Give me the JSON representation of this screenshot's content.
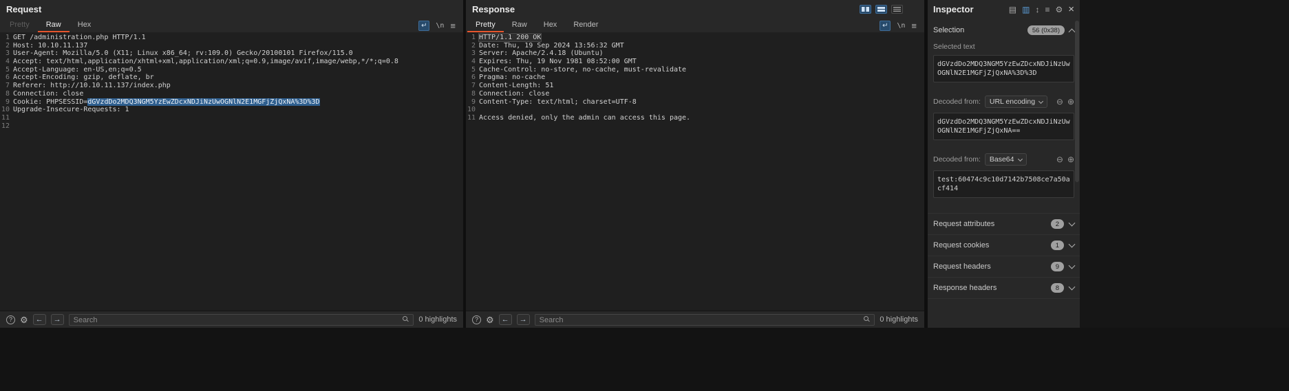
{
  "colors": {
    "accent_orange": "#e8562d",
    "selection_blue": "#2f5f8f",
    "active_icon_blue": "#274a6b"
  },
  "request": {
    "title": "Request",
    "tabs": [
      {
        "label": "Pretty",
        "state": "disabled"
      },
      {
        "label": "Raw",
        "state": "active"
      },
      {
        "label": "Hex",
        "state": "normal"
      }
    ],
    "lines": [
      {
        "num": "1",
        "spans": [
          {
            "t": "GET /administration.php HTTP/1.1"
          }
        ]
      },
      {
        "num": "2",
        "spans": [
          {
            "t": "Host: 10.10.11.137"
          }
        ]
      },
      {
        "num": "3",
        "spans": [
          {
            "t": "User-Agent: Mozilla/5.0 (X11; Linux x86_64; rv:109.0) Gecko/20100101 Firefox/115.0"
          }
        ]
      },
      {
        "num": "4",
        "spans": [
          {
            "t": "Accept: text/html,application/xhtml+xml,application/xml;q=0.9,image/avif,image/webp,*/*;q=0.8"
          }
        ]
      },
      {
        "num": "5",
        "spans": [
          {
            "t": "Accept-Language: en-US,en;q=0.5"
          }
        ]
      },
      {
        "num": "6",
        "spans": [
          {
            "t": "Accept-Encoding: gzip, deflate, br"
          }
        ]
      },
      {
        "num": "7",
        "spans": [
          {
            "t": "Referer: http://10.10.11.137/index.php"
          }
        ]
      },
      {
        "num": "8",
        "spans": [
          {
            "t": "Connection: close"
          }
        ]
      },
      {
        "num": "9",
        "spans": [
          {
            "t": "Cookie: PHPSESSID="
          },
          {
            "t": "dGVzdDo2MDQ3NGM5YzEwZDcxNDJiNzUwOGNlN2E1MGFjZjQxNA%3D%3D",
            "style": "selected"
          }
        ]
      },
      {
        "num": "10",
        "spans": [
          {
            "t": "Upgrade-Insecure-Requests: 1"
          }
        ]
      },
      {
        "num": "11",
        "spans": []
      },
      {
        "num": "12",
        "spans": []
      }
    ],
    "search": {
      "placeholder": "Search",
      "highlights": "0 highlights"
    }
  },
  "response": {
    "title": "Response",
    "tabs": [
      {
        "label": "Pretty",
        "state": "active"
      },
      {
        "label": "Raw",
        "state": "normal"
      },
      {
        "label": "Hex",
        "state": "normal"
      },
      {
        "label": "Render",
        "state": "normal"
      }
    ],
    "lines": [
      {
        "num": "1",
        "spans": [
          {
            "t": "HTTP/1.1 200 OK",
            "style": "boxed"
          }
        ]
      },
      {
        "num": "2",
        "spans": [
          {
            "t": "Date: Thu, 19 Sep 2024 13:56:32 GMT"
          }
        ]
      },
      {
        "num": "3",
        "spans": [
          {
            "t": "Server: Apache/2.4.18 (Ubuntu)"
          }
        ]
      },
      {
        "num": "4",
        "spans": [
          {
            "t": "Expires: Thu, 19 Nov 1981 08:52:00 GMT"
          }
        ]
      },
      {
        "num": "5",
        "spans": [
          {
            "t": "Cache-Control: no-store, no-cache, must-revalidate"
          }
        ]
      },
      {
        "num": "6",
        "spans": [
          {
            "t": "Pragma: no-cache"
          }
        ]
      },
      {
        "num": "7",
        "spans": [
          {
            "t": "Content-Length: 51"
          }
        ]
      },
      {
        "num": "8",
        "spans": [
          {
            "t": "Connection: close"
          }
        ]
      },
      {
        "num": "9",
        "spans": [
          {
            "t": "Content-Type: text/html; charset=UTF-8"
          }
        ]
      },
      {
        "num": "10",
        "spans": []
      },
      {
        "num": "11",
        "spans": [
          {
            "t": "Access denied, only the admin can access this page."
          }
        ]
      }
    ],
    "search": {
      "placeholder": "Search",
      "highlights": "0 highlights"
    }
  },
  "inspector": {
    "title": "Inspector",
    "selection": {
      "label": "Selection",
      "badge": "56 (0x38)"
    },
    "selected_text": {
      "label": "Selected text",
      "value": "dGVzdDo2MDQ3NGM5YzEwZDcxNDJiNzUwOGNlN2E1MGFjZjQxNA%3D%3D"
    },
    "decoders": [
      {
        "label": "Decoded from:",
        "method": "URL encoding",
        "value": "dGVzdDo2MDQ3NGM5YzEwZDcxNDJiNzUwOGNlN2E1MGFjZjQxNA=="
      },
      {
        "label": "Decoded from:",
        "method": "Base64",
        "value": "test:60474c9c10d7142b7508ce7a50acf414"
      }
    ],
    "sections": [
      {
        "label": "Request attributes",
        "count": "2"
      },
      {
        "label": "Request cookies",
        "count": "1"
      },
      {
        "label": "Request headers",
        "count": "9"
      },
      {
        "label": "Response headers",
        "count": "8"
      }
    ]
  },
  "icons": {
    "newline": "\\n",
    "menu": "≡",
    "wrap": "↵",
    "gear": "⚙",
    "help": "?",
    "prev": "←",
    "next": "→",
    "close": "×",
    "minus": "⊖",
    "plus": "⊕",
    "dock_a": "▤",
    "dock_b": "▥",
    "expand": "↕",
    "collapse": "≡"
  }
}
